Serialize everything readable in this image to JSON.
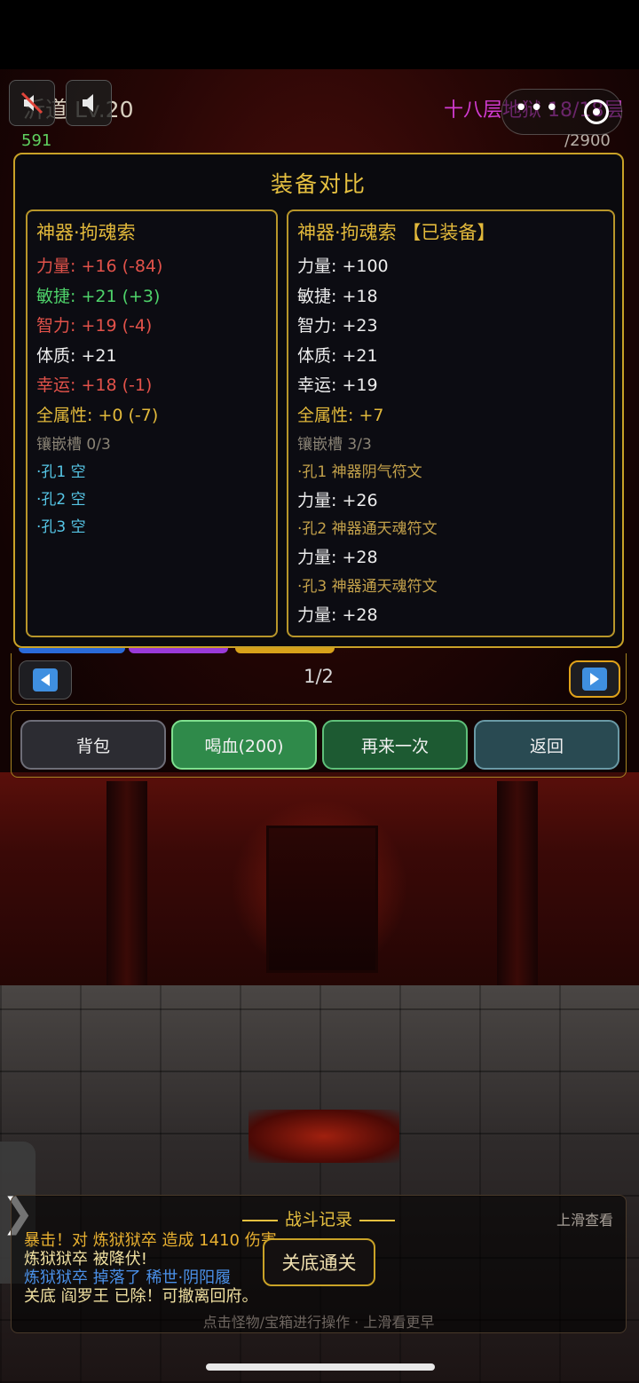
{
  "header": {
    "player_name": "沂道 Lv.20",
    "floor_label": "十八层地狱 18/18层",
    "hp_current": "591",
    "hp_max": "/2900"
  },
  "dialog": {
    "title": "装备对比",
    "left": {
      "title": "神器·拘魂索",
      "stats": [
        {
          "text": "力量: +16 (-84)",
          "color": "red"
        },
        {
          "text": "敏捷: +21 (+3)",
          "color": "green"
        },
        {
          "text": "智力: +19 (-4)",
          "color": "red"
        },
        {
          "text": "体质: +21",
          "color": "white"
        },
        {
          "text": "幸运: +18 (-1)",
          "color": "red"
        },
        {
          "text": "全属性: +0 (-7)",
          "color": "gold"
        }
      ],
      "sockets_label": "镶嵌槽 0/3",
      "sockets": [
        "·孔1 空",
        "·孔2 空",
        "·孔3 空"
      ]
    },
    "right": {
      "title": "神器·拘魂索 【已装备】",
      "stats": [
        "力量: +100",
        "敏捷: +18",
        "智力: +23",
        "体质: +21",
        "幸运: +19"
      ],
      "all_stat": "全属性: +7",
      "sockets_label": "镶嵌槽 3/3",
      "socket1": "·孔1 神器阴气符文",
      "socket1_bonus": "力量: +26",
      "socket2": "·孔2 神器通天魂符文",
      "socket2_bonus": "力量: +28",
      "socket3": "·孔3 神器通天魂符文",
      "socket3_bonus": "力量: +28"
    }
  },
  "pager": {
    "page": "1/2"
  },
  "actions": {
    "bag": "背包",
    "drink_blood": "喝血(200)",
    "retry": "再来一次",
    "back": "返回"
  },
  "log": {
    "title": "战斗记录",
    "hint": "上滑查看",
    "lines": [
      {
        "text": "暴击！对 炼狱狱卒 造成 1410 伤害",
        "color": "#e8b030"
      },
      {
        "text": "炼狱狱卒 被降伏!",
        "color": "#f0e0a0"
      },
      {
        "text": "炼狱狱卒 掉落了 稀世·阴阳履",
        "color": "#4a90e8"
      },
      {
        "text": "关底 阎罗王 已除！可撤离回府。",
        "color": "#f0e0a0"
      }
    ],
    "footer": "点击怪物/宝箱进行操作 · 上滑看更早",
    "boss_button": "关底通关"
  },
  "colors": {
    "gold_border": "#c9a227",
    "accent_gold": "#e6c040",
    "stat_red": "#e2524a",
    "stat_green": "#4ed36a",
    "floor_magenta": "#d23bd2"
  },
  "icons": [
    "mute-icon",
    "speaker-icon",
    "more-dots-icon",
    "target-icon",
    "arrow-left-icon",
    "arrow-right-icon",
    "chevron-right-icon"
  ]
}
